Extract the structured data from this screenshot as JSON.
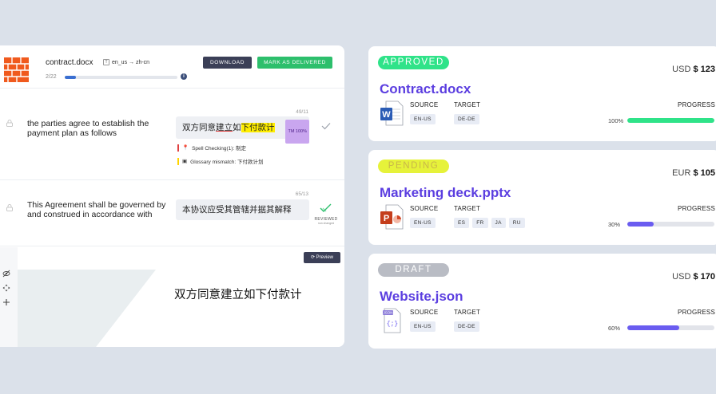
{
  "editor": {
    "filename": "contract.docx",
    "lang_pair": "en_us → zh-cn",
    "progress_text": "2/22",
    "progress_fraction": 0.1,
    "download_label": "DOWNLOAD",
    "deliver_label": "MARK AS DELIVERED",
    "segments": [
      {
        "number": "49/11",
        "source": "the parties agree to establish the payment plan as follows",
        "target_plain": "双方同意",
        "target_underlined": "建立",
        "target_mid": "如",
        "target_highlight": "下付款计",
        "tm_badge": "TM 100%",
        "issues": [
          {
            "text": "Spell Checking(1): 制定",
            "color": "#e04040"
          },
          {
            "text": "Glossary mismatch: 下付款计划",
            "color": "#ffd400"
          }
        ]
      },
      {
        "number": "65/13",
        "source": "This Agreement shall be governed by and construed in accordance with",
        "target": "本协议应受其管辖并据其解释",
        "reviewed_label": "REVIEWED",
        "reviewed_sub": "non changed"
      }
    ],
    "preview_button": "Preview",
    "preview_text": "双方同意建立如下付款计"
  },
  "cards": [
    {
      "status": "APPROVED",
      "status_bg": "#2fe389",
      "status_color": "#ffffff",
      "currency": "USD",
      "amount": "$ 123",
      "title": "Contract.docx",
      "file_icon": "word-file-icon",
      "source_label": "SOURCE",
      "target_label": "TARGET",
      "source": "EN-US",
      "targets": [
        "DE-DE"
      ],
      "progress_label": "PROGRESS",
      "progress_text": "100%",
      "progress": 1.0,
      "bar_color": "#2fe389"
    },
    {
      "status": "PENDING",
      "status_bg": "#e6f23a",
      "status_color": "#c9b64a",
      "currency": "EUR",
      "amount": "$ 105",
      "title": "Marketing deck.pptx",
      "file_icon": "powerpoint-file-icon",
      "source_label": "SOURCE",
      "target_label": "TARGET",
      "source": "EN-US",
      "targets": [
        "ES",
        "FR",
        "JA",
        "RU"
      ],
      "progress_label": "PROGRESS",
      "progress_text": "30%",
      "progress": 0.3,
      "bar_color": "#6a5cf0"
    },
    {
      "status": "DRAFT",
      "status_bg": "#b9bcc4",
      "status_color": "#ffffff",
      "currency": "USD",
      "amount": "$ 170",
      "title": "Website.json",
      "file_icon": "json-file-icon",
      "source_label": "SOURCE",
      "target_label": "TARGET",
      "source": "EN-US",
      "targets": [
        "DE-DE"
      ],
      "progress_label": "PROGRESS",
      "progress_text": "60%",
      "progress": 0.6,
      "bar_color": "#6a5cf0"
    }
  ]
}
